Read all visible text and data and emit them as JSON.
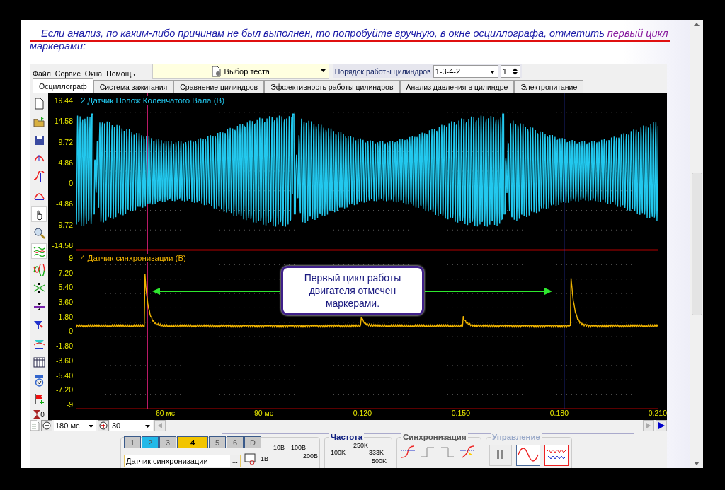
{
  "instruction": {
    "text": "Если анализ, по каким-либо причинам не был выполнен, то попробуйте вручную, в окне осциллографа, отметить ",
    "highlight": "первый цикл",
    "rest": " маркерами:"
  },
  "menu": [
    "Файл",
    "Сервис",
    "Окна",
    "Помощь"
  ],
  "test_select": {
    "value": "Выбор теста"
  },
  "cylinder_order": {
    "label": "Порядок работы цилиндров",
    "value": "1-3-4-2",
    "spin": "1"
  },
  "tabs": [
    {
      "label": "Осциллограф",
      "selected": true
    },
    {
      "label": "Система зажигания",
      "selected": false
    },
    {
      "label": "Сравнение цилиндров",
      "selected": false
    },
    {
      "label": "Эффективность работы цилиндров",
      "selected": false
    },
    {
      "label": "Анализ давления в цилиндре",
      "selected": false
    },
    {
      "label": "Электропитание",
      "selected": false
    }
  ],
  "tools": [
    {
      "kind": "new",
      "selected": false
    },
    {
      "kind": "open",
      "selected": false
    },
    {
      "kind": "save",
      "selected": false
    },
    {
      "kind": "autoscale",
      "selected": false
    },
    {
      "kind": "vscale",
      "selected": false
    },
    {
      "kind": "hscale",
      "selected": false
    },
    {
      "kind": "hand",
      "selected": true
    },
    {
      "kind": "zoom",
      "selected": false
    },
    {
      "kind": "overlay",
      "selected": true
    },
    {
      "kind": "waves",
      "selected": false
    },
    {
      "kind": "cross",
      "selected": false
    },
    {
      "kind": "divide",
      "selected": false
    },
    {
      "kind": "filter",
      "selected": false
    },
    {
      "kind": "channel",
      "selected": false
    },
    {
      "kind": "table",
      "selected": false
    },
    {
      "kind": "auto",
      "selected": false
    },
    {
      "kind": "flag",
      "selected": false
    }
  ],
  "marker_count": "0",
  "channels": [
    {
      "title": "2 Датчик Полож Коленчатого Вала (В)",
      "color": "#22c8ee",
      "kind": "crank",
      "yticks": [
        "19.44",
        "14.58",
        "9.72",
        "4.86",
        "0",
        "-4.86",
        "-9.72",
        "-14.58"
      ]
    },
    {
      "title": "4 Датчик синхронизации (В)",
      "color": "#f0b400",
      "kind": "sync",
      "yticks": [
        "9",
        "7.20",
        "5.40",
        "3.60",
        "1.80",
        "0",
        "-1.80",
        "-3.60",
        "-5.40",
        "-7.20",
        "-9"
      ]
    }
  ],
  "xticks": [
    "60 мс",
    "90 мс",
    "0.120",
    "0.150",
    "0.180",
    "0.210"
  ],
  "callout": "Первый цикл работы двигателя отмечен маркерами.",
  "timebase": "180 мс",
  "points": "30",
  "channel_buttons": [
    {
      "label": "1",
      "selected": false,
      "color": "#c8c8c8"
    },
    {
      "label": "2",
      "selected": false,
      "color": "#22b8e8"
    },
    {
      "label": "3",
      "selected": false,
      "color": "#c8c8c8"
    },
    {
      "label": "4",
      "selected": true,
      "color": "#f2c400"
    },
    {
      "label": "5",
      "selected": false,
      "color": "#c8c8c8"
    },
    {
      "label": "6",
      "selected": false,
      "color": "#c8c8c8"
    },
    {
      "label": "D",
      "selected": false,
      "color": "#c8c8c8"
    }
  ],
  "sensor": "Датчик синхронизации",
  "sensor_button": "...",
  "voltage_labels": [
    "10В",
    "100В",
    "1В",
    "200В"
  ],
  "frequency": {
    "title": "Частота",
    "labels": [
      "100K",
      "250K",
      "333K",
      "500K"
    ]
  },
  "sync_title": "Синхронизация",
  "control_title": "Управление"
}
